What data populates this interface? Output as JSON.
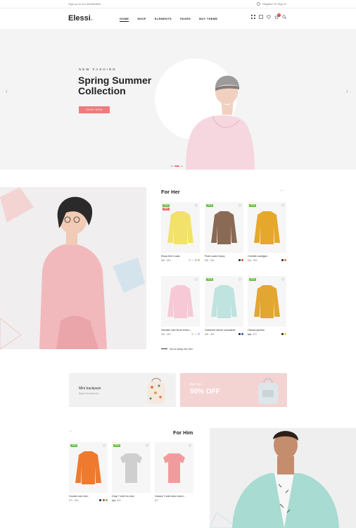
{
  "topbar": {
    "signup": "Sign up to our newsletters",
    "account": "Register Or Sign in"
  },
  "header": {
    "logo": "Elessi",
    "logo_dot": ".",
    "nav": [
      "HOME",
      "SHOP",
      "ELEMENTS",
      "PAGES",
      "BUY THEME"
    ],
    "cart_count": "0"
  },
  "hero": {
    "kicker": "NEW FASHION",
    "title": "Spring Summer Collection",
    "button": "SHOP NOW",
    "prev": "‹",
    "next": "›"
  },
  "her": {
    "title": "For Her",
    "pager": "‹ ›",
    "link": "Go to shop for Her",
    "products": [
      {
        "name": "Eissa Knit Coats",
        "price": "$86 - $89",
        "tags": [
          "SALE",
          "NEW"
        ],
        "swatches": [
          "#f2d0d0",
          "#e9e9e9",
          "#b7c9e9",
          "#e3c16b"
        ]
      },
      {
        "name": "Pearl coats heavy",
        "price": "$86 - $89",
        "tags": [
          "SALE"
        ],
        "swatches": [
          "#222222",
          "#d8452c"
        ]
      },
      {
        "name": "Chenille cardigan",
        "price": "$86 - $89",
        "tags": [
          "SALE"
        ],
        "swatches": [
          "#222222",
          "#d8732c"
        ]
      },
      {
        "name": "Sweater with floral embro...",
        "price": "$86 - $89",
        "tags": [],
        "swatches": [
          "#f2d0d0",
          "#e9e9e9",
          "#b7c9e9"
        ]
      },
      {
        "name": "Gathered sleeve sweatshirt",
        "price": "$86 - $89",
        "tags": [
          "SALE"
        ],
        "swatches": [
          "#222222",
          "#2a56c0"
        ]
      },
      {
        "name": "Classic jackets",
        "price": "$79",
        "old": "$99",
        "tags": [
          "SALE"
        ],
        "swatches": [
          "#222222",
          "#f2d23c"
        ]
      }
    ]
  },
  "banners": {
    "b1_title": "Mini backpack",
    "b1_sub": "Bags & Accessories",
    "b2_kicker": "Big Sale",
    "b2_title": "50% OFF"
  },
  "him": {
    "title": "For Him",
    "pager": "‹ ›",
    "products": [
      {
        "name": "Hoodie over men",
        "price": "$79 - $86",
        "tags": [
          "SALE"
        ],
        "swatches": [
          "#222222",
          "#d83b3b",
          "#6cc04a"
        ]
      },
      {
        "name": "Gray T-shirt for men",
        "price": "$59",
        "old": "$79",
        "tags": [
          "SALE"
        ],
        "swatches": []
      },
      {
        "name": "Classic T-shirt short sleev...",
        "price": "$37",
        "tags": [],
        "swatches": []
      }
    ]
  },
  "colors": {
    "accent": "#ef7b7b",
    "sale": "#6cc04a",
    "new": "#ef6b6b",
    "pink": "#f4d3d3"
  }
}
